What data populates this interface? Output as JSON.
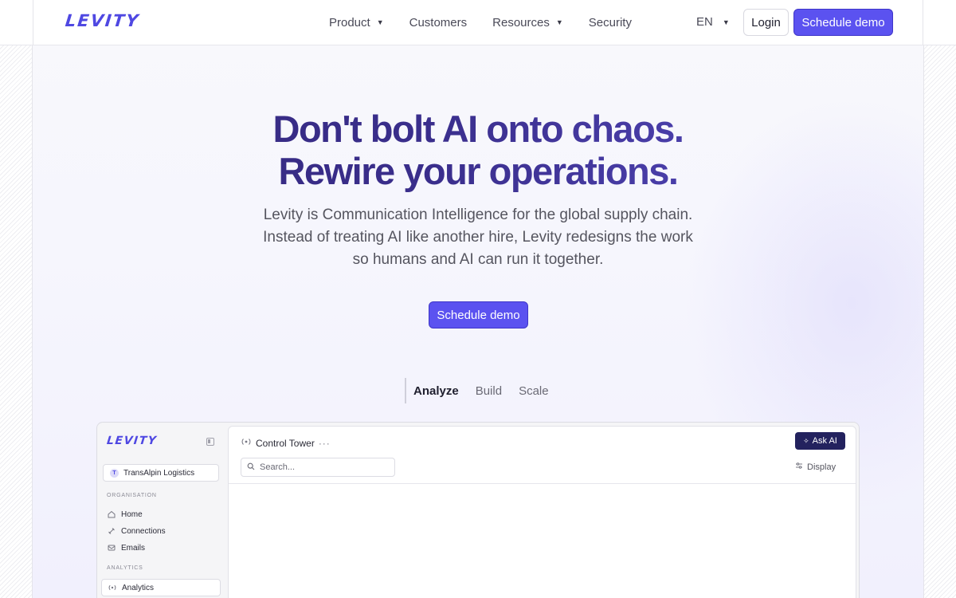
{
  "nav": {
    "logo": "LEVITY",
    "links": [
      {
        "label": "Product",
        "has_dropdown": true
      },
      {
        "label": "Customers",
        "has_dropdown": false
      },
      {
        "label": "Resources",
        "has_dropdown": true
      },
      {
        "label": "Security",
        "has_dropdown": false
      }
    ],
    "language": "EN",
    "login_label": "Login",
    "demo_label": "Schedule demo"
  },
  "hero": {
    "title_line1": "Don't bolt AI onto chaos.",
    "title_line2": "Rewire your operations.",
    "subtitle": "Levity is Communication Intelligence for the global supply chain. Instead of treating AI like another hire, Levity redesigns the work so humans and AI can run it together.",
    "cta_label": "Schedule demo"
  },
  "tabs": [
    {
      "label": "Analyze",
      "active": true
    },
    {
      "label": "Build",
      "active": false
    },
    {
      "label": "Scale",
      "active": false
    }
  ],
  "app": {
    "logo": "LEVITY",
    "org": {
      "initial": "T",
      "name": "TransAlpin Logistics"
    },
    "sections": {
      "organisation": "ORGANISATION",
      "analytics": "ANALYTICS"
    },
    "org_items": [
      {
        "label": "Home",
        "icon": "home-icon"
      },
      {
        "label": "Connections",
        "icon": "link-icon"
      },
      {
        "label": "Emails",
        "icon": "mail-icon"
      }
    ],
    "analytics_items": [
      {
        "label": "Analytics",
        "icon": "radar-icon",
        "active": true
      }
    ],
    "main": {
      "title": "Control Tower",
      "ask_ai_label": "Ask AI",
      "search_placeholder": "Search...",
      "display_label": "Display"
    }
  },
  "colors": {
    "accent": "#5b52f0",
    "title_dark": "#33277a",
    "ask_ai_bg": "#23225e"
  }
}
